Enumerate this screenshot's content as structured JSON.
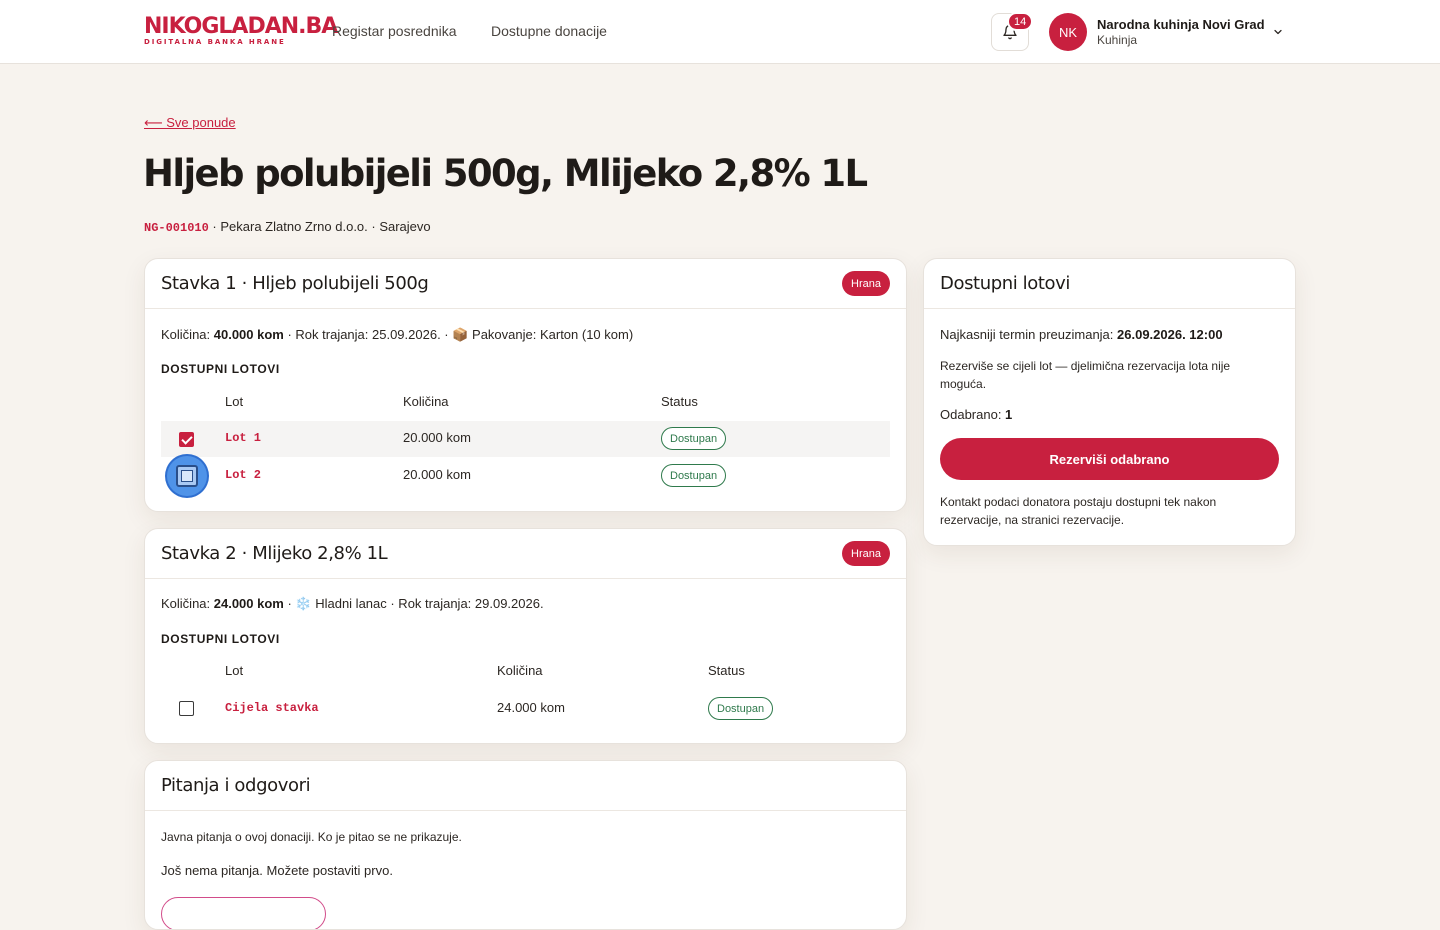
{
  "header": {
    "logo_main": "NIKOGLADAN.BA",
    "logo_sub": "DIGITALNA BANKA HRANE",
    "nav": [
      {
        "label": "Registar posrednika"
      },
      {
        "label": "Dostupne donacije"
      }
    ],
    "notifications_count": "14",
    "user": {
      "initials": "NK",
      "name": "Narodna kuhinja Novi Grad",
      "role": "Kuhinja"
    }
  },
  "page": {
    "back_link": "⟵ Sve ponude",
    "title": "Hljeb polubijeli 500g, Mlijeko 2,8% 1L",
    "code": "NG-001010",
    "meta_rest": " · Pekara Zlatno Zrno d.o.o. · Sarajevo"
  },
  "items": [
    {
      "title": "Stavka 1 · Hljeb polubijeli 500g",
      "category": "Hrana",
      "info_prefix": "Količina: ",
      "info_qty": "40.000 kom",
      "info_rest": " · Rok trajanja: 25.09.2026. · 📦 Pakovanje: Karton (10 kom)",
      "section_label": "DOSTUPNI LOTOVI",
      "columns": [
        "Lot",
        "Količina",
        "Status"
      ],
      "lots": [
        {
          "name": "Lot 1",
          "qty": "20.000 kom",
          "status": "Dostupan",
          "checked": true
        },
        {
          "name": "Lot 2",
          "qty": "20.000 kom",
          "status": "Dostupan",
          "checked": false
        }
      ]
    },
    {
      "title": "Stavka 2 · Mlijeko 2,8% 1L",
      "category": "Hrana",
      "info_prefix": "Količina: ",
      "info_qty": "24.000 kom",
      "info_rest": " · ❄️ Hladni lanac · Rok trajanja: 29.09.2026.",
      "section_label": "DOSTUPNI LOTOVI",
      "columns": [
        "Lot",
        "Količina",
        "Status"
      ],
      "lots": [
        {
          "name": "Cijela stavka",
          "qty": "24.000 kom",
          "status": "Dostupan",
          "checked": false
        }
      ]
    }
  ],
  "qa": {
    "title": "Pitanja i odgovori",
    "note": "Javna pitanja o ovoj donaciji. Ko je pitao se ne prikazuje.",
    "empty": "Još nema pitanja. Možete postaviti prvo."
  },
  "sidebar": {
    "title": "Dostupni lotovi",
    "deadline_label": "Najkasniji termin preuzimanja: ",
    "deadline_value": "26.09.2026. 12:00",
    "note": "Rezerviše se cijeli lot — djelimična rezervacija lota nije moguća.",
    "selected_label": "Odabrano: ",
    "selected_value": "1",
    "reserve_button": "Rezerviši odabrano",
    "contact_note": "Kontakt podaci donatora postaju dostupni tek nakon rezervacije, na stranici rezervacije."
  },
  "colors": {
    "brand": "#c8203f",
    "status_ok": "#2f7a4c",
    "background": "#f7f3ee"
  }
}
